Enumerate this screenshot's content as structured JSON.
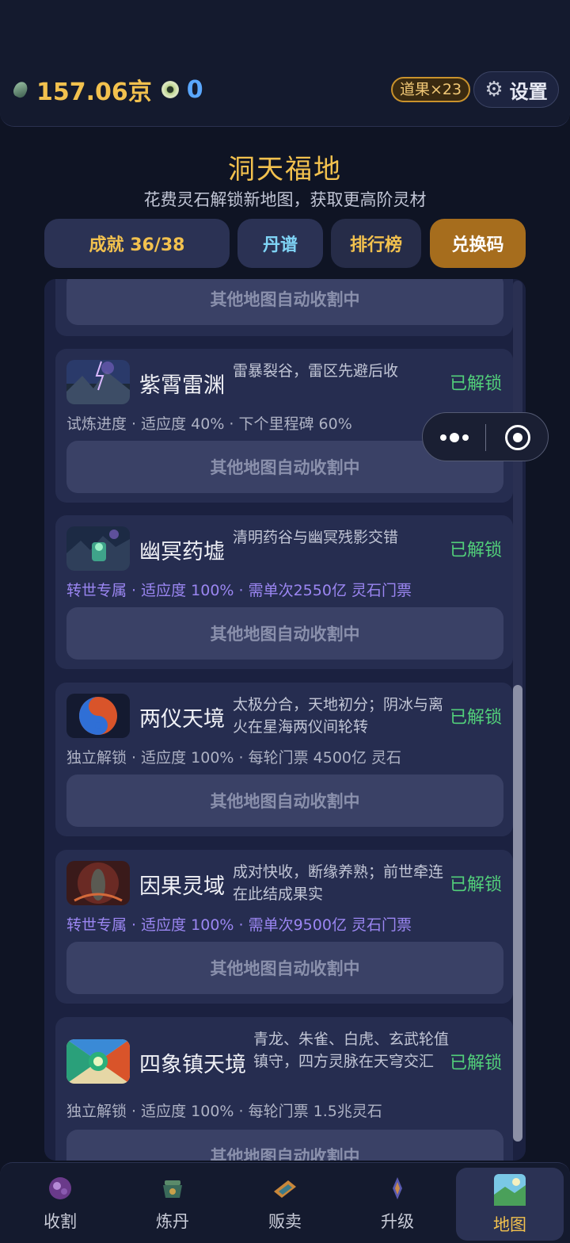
{
  "header": {
    "spirit_stone": "157.06京",
    "eye_currency": "0",
    "daoguo_badge": "道果×23",
    "settings_label": "设置"
  },
  "page": {
    "title": "洞天福地",
    "subtitle": "花费灵石解锁新地图，获取更高阶灵材"
  },
  "tabs": {
    "achievement": "成就 36/38",
    "recipes": "丹谱",
    "ranking": "排行榜",
    "redeem": "兑换码"
  },
  "harvest_label": "其他地图自动收割中",
  "maps": [
    {
      "name": "紫霄雷渊",
      "desc": "雷暴裂谷，雷区先避后收",
      "status": "已解锁",
      "meta": "试炼进度 · 适应度 40% · 下个里程碑 60%"
    },
    {
      "name": "幽冥药墟",
      "desc": "清明药谷与幽冥残影交错",
      "status": "已解锁",
      "meta": "转世专属 · 适应度 100% · 需单次2550亿 灵石门票"
    },
    {
      "name": "两仪天境",
      "desc": "太极分合，天地初分；阴冰与离火在星海两仪间轮转",
      "status": "已解锁",
      "meta": "独立解锁 · 适应度 100% · 每轮门票 4500亿 灵石"
    },
    {
      "name": "因果灵域",
      "desc": "成对快收，断缘养熟；前世牵连在此结成果实",
      "status": "已解锁",
      "meta": "转世专属 · 适应度 100% · 需单次9500亿 灵石门票"
    },
    {
      "name": "四象镇天境",
      "desc": "青龙、朱雀、白虎、玄武轮值镇守，四方灵脉在天穹交汇",
      "status": "已解锁",
      "meta": "独立解锁 · 适应度 100% · 每轮门票 1.5兆灵石"
    }
  ],
  "nav": [
    {
      "label": "收割",
      "icon": "harvest-icon"
    },
    {
      "label": "炼丹",
      "icon": "cauldron-icon"
    },
    {
      "label": "贩卖",
      "icon": "scroll-icon"
    },
    {
      "label": "升级",
      "icon": "upgrade-icon"
    },
    {
      "label": "地图",
      "icon": "map-icon"
    }
  ],
  "colors": {
    "gold": "#f2c14e",
    "unlocked_green": "#52d07a",
    "purple_meta": "#9b86f2",
    "redeem_tab": "#a66d1d"
  }
}
